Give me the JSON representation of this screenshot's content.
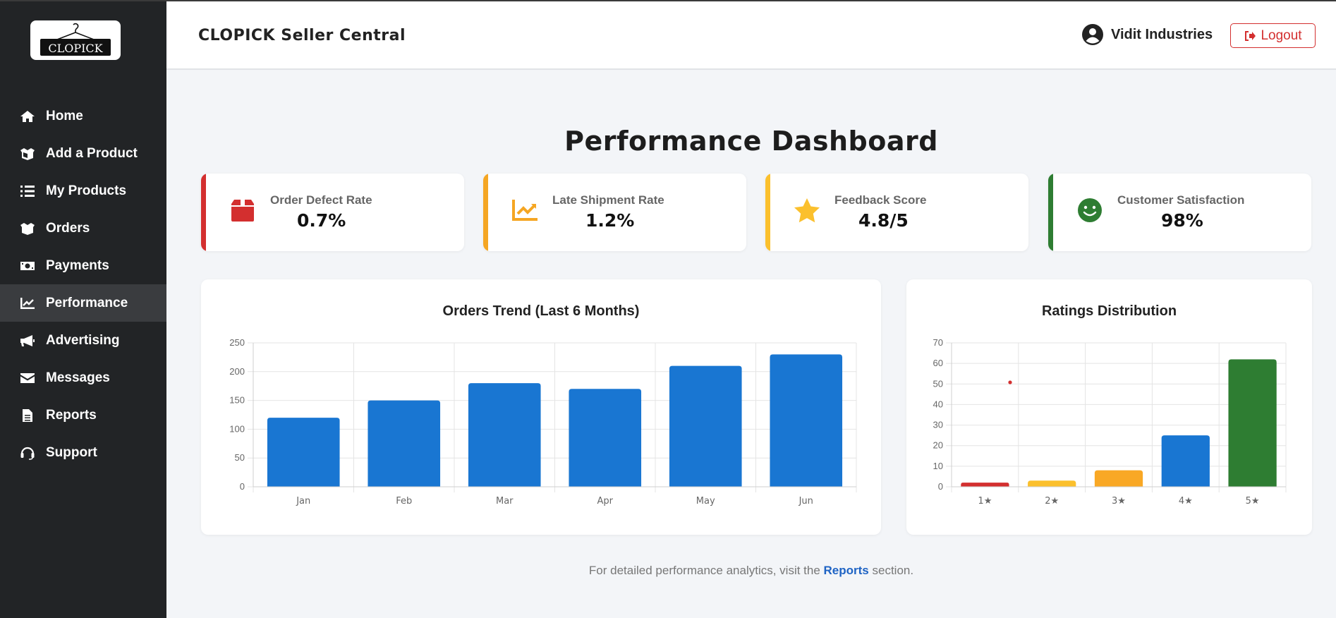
{
  "sidebar": {
    "logo_text": "CLOPICK",
    "items": [
      {
        "label": "Home",
        "icon": "home-icon"
      },
      {
        "label": "Add a Product",
        "icon": "box-open-icon"
      },
      {
        "label": "My Products",
        "icon": "list-icon"
      },
      {
        "label": "Orders",
        "icon": "box-icon"
      },
      {
        "label": "Payments",
        "icon": "money-bill-icon"
      },
      {
        "label": "Performance",
        "icon": "chart-line-icon",
        "active": true
      },
      {
        "label": "Advertising",
        "icon": "megaphone-icon"
      },
      {
        "label": "Messages",
        "icon": "envelope-icon"
      },
      {
        "label": "Reports",
        "icon": "file-icon"
      },
      {
        "label": "Support",
        "icon": "headset-icon"
      }
    ]
  },
  "header": {
    "brand": "CLOPICK Seller Central",
    "user_name": "Vidit Industries",
    "logout_label": "Logout"
  },
  "main": {
    "title": "Performance Dashboard",
    "kpis": [
      {
        "label": "Order Defect Rate",
        "value": "0.7%",
        "color": "#d32f2f",
        "icon": "box-icon"
      },
      {
        "label": "Late Shipment Rate",
        "value": "1.2%",
        "color": "#f5a623",
        "icon": "chart-line-icon"
      },
      {
        "label": "Feedback Score",
        "value": "4.8/5",
        "color": "#fbc02d",
        "icon": "star-icon"
      },
      {
        "label": "Customer Satisfaction",
        "value": "98%",
        "color": "#2e7d32",
        "icon": "smile-icon"
      }
    ],
    "footer_prefix": "For detailed performance analytics, visit the ",
    "footer_link": "Reports",
    "footer_suffix": " section."
  },
  "chart_data": [
    {
      "type": "bar",
      "title": "Orders Trend (Last 6 Months)",
      "categories": [
        "Jan",
        "Feb",
        "Mar",
        "Apr",
        "May",
        "Jun"
      ],
      "values": [
        120,
        150,
        180,
        170,
        210,
        230
      ],
      "ylim": [
        0,
        250
      ],
      "yticks": [
        0,
        50,
        100,
        150,
        200,
        250
      ],
      "color": "#1976d2",
      "grid": true,
      "xlabel": "",
      "ylabel": ""
    },
    {
      "type": "bar",
      "title": "Ratings Distribution",
      "categories": [
        "1★",
        "2★",
        "3★",
        "4★",
        "5★"
      ],
      "values": [
        2,
        3,
        8,
        25,
        62
      ],
      "colors": [
        "#d32f2f",
        "#fbc02d",
        "#f9a825",
        "#1976d2",
        "#2e7d32"
      ],
      "ylim": [
        0,
        70
      ],
      "yticks": [
        0,
        10,
        20,
        30,
        40,
        50,
        60,
        70
      ],
      "grid": true,
      "xlabel": "",
      "ylabel": ""
    }
  ]
}
